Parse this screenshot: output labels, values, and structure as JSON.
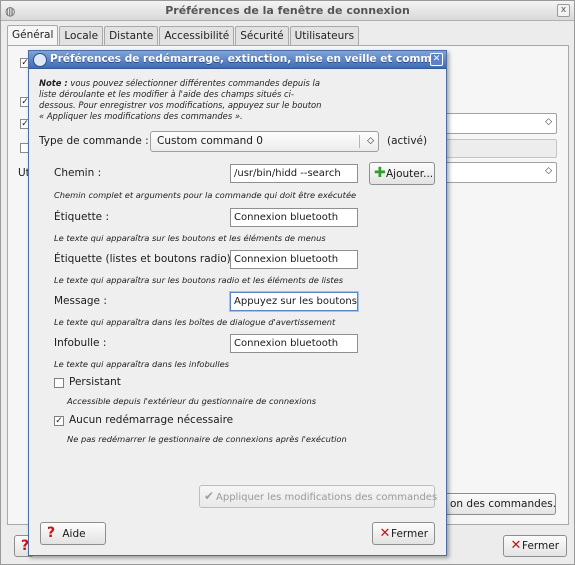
{
  "main_window": {
    "title": "Préférences de la fenêtre de connexion",
    "close_glyph": "x",
    "tabs": [
      "Général",
      "Locale",
      "Distante",
      "Accessibilité",
      "Sécurité",
      "Utilisateurs"
    ],
    "active_tab": "Général",
    "label_fragment": "Ut",
    "combo_arrow": "◇",
    "partial_button_label": "on des commandes...",
    "close_button_label": "Fermer"
  },
  "dialog": {
    "title": "Préférences de redémarrage, extinction, mise en veille et commandes",
    "note_bold": "Note :",
    "note_text": "vous pouvez sélectionner différentes commandes depuis la liste déroulante et les modifier à l'aide des champs situés ci-dessous. Pour enregistrer vos modifications, appuyez sur le bouton « Appliquer les modifications des commandes ».",
    "command_type": {
      "label": "Type de commande :",
      "selected": "Custom command 0",
      "status": "(activé)"
    },
    "path": {
      "label": "Chemin :",
      "value": "/usr/bin/hidd --search",
      "add_button": "Ajouter...",
      "hint": "Chemin complet et arguments pour la commande qui doit être exécutée"
    },
    "etiquette": {
      "label": "Étiquette :",
      "value": "Connexion bluetooth",
      "hint": "Le texte qui apparaîtra sur les boutons et les éléments de menus"
    },
    "etiquette_radio": {
      "label": "Étiquette (listes et boutons radio) :",
      "value": "Connexion bluetooth",
      "hint": "Le texte qui apparaîtra sur les boutons radio et les éléments de listes"
    },
    "message": {
      "label": "Message :",
      "value": "Appuyez sur les boutons d",
      "hint": "Le texte qui apparaîtra dans les boîtes de dialogue d'avertissement"
    },
    "infobulle": {
      "label": "Infobulle :",
      "value": "Connexion bluetooth",
      "hint": "Le texte qui apparaîtra dans les infobulles"
    },
    "persistant": {
      "label": "Persistant",
      "checked": false,
      "hint": "Accessible depuis l'extérieur du gestionnaire de connexions"
    },
    "no_restart": {
      "label": "Aucun redémarrage nécessaire",
      "checked": true,
      "hint": "Ne pas redémarrer le gestionnaire de connexions après l'exécution"
    },
    "apply_button": "Appliquer les modifications des commandes",
    "help_button": "Aide",
    "close_button": "Fermer"
  },
  "colors": {
    "dialog_titlebar": "#3f6bb5",
    "window_bg": "#ececec",
    "add_icon": "#2f9e2f",
    "close_icon": "#cc1111"
  }
}
